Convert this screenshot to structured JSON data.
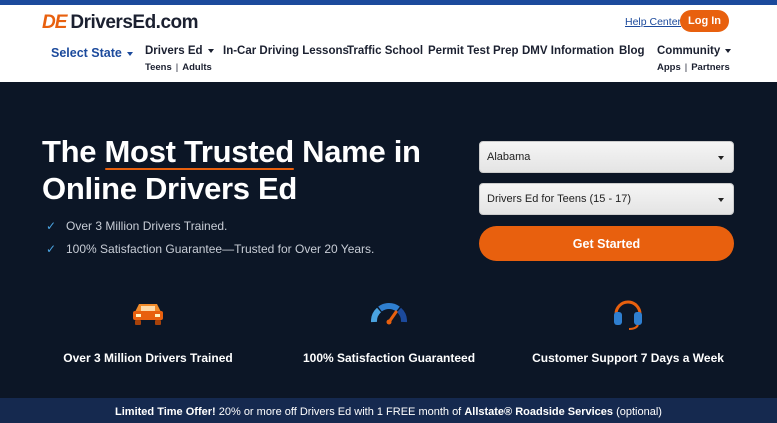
{
  "header": {
    "logo_mark": "DE",
    "logo_text": "DriversEd.com",
    "help_label": "Help Center",
    "login_label": "Log In"
  },
  "nav": {
    "select_state": "Select State",
    "drivers_ed": "Drivers Ed",
    "drivers_ed_sub_1": "Teens",
    "drivers_ed_sub_2": "Adults",
    "in_car": "In-Car Driving Lessons",
    "traffic_school": "Traffic School",
    "permit_test": "Permit Test Prep",
    "dmv_info": "DMV Information",
    "blog": "Blog",
    "community": "Community",
    "community_sub_1": "Apps",
    "community_sub_2": "Partners"
  },
  "hero": {
    "headline_1": "The ",
    "headline_em": "Most Trusted",
    "headline_2": " Name in Online Drivers Ed",
    "bullets": [
      "Over 3 Million Drivers Trained.",
      "100% Satisfaction Guarantee—Trusted for Over 20 Years."
    ],
    "state_select": "Alabama",
    "course_select": "Drivers Ed for Teens (15 - 17)",
    "cta_label": "Get Started"
  },
  "features": [
    {
      "label": "Over 3 Million Drivers Trained",
      "icon": "car-icon"
    },
    {
      "label": "100% Satisfaction Guaranteed",
      "icon": "gauge-icon"
    },
    {
      "label": "Customer Support 7 Days a Week",
      "icon": "headset-icon"
    }
  ],
  "promo": {
    "prefix": "Limited Time Offer!",
    "text": " 20% or more off Drivers Ed with 1 FREE month of ",
    "brand": "Allstate® Roadside Services",
    "suffix": " (optional)"
  },
  "colors": {
    "accent": "#e8600e",
    "brand_blue": "#1c4a9c",
    "hero_bg": "#0c1626"
  }
}
